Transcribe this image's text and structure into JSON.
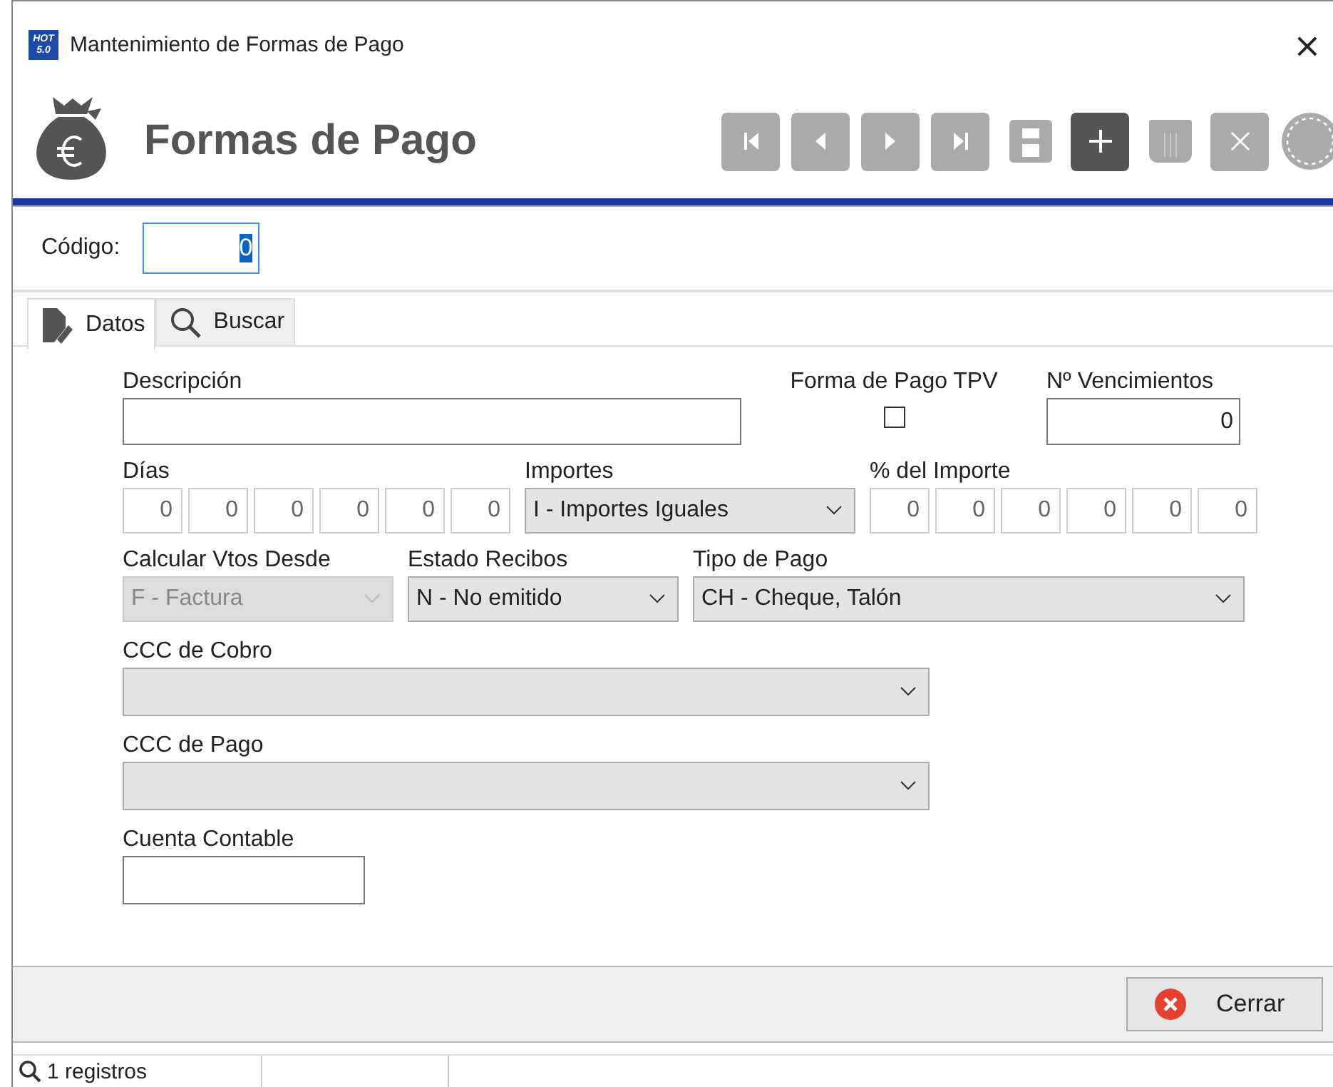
{
  "window": {
    "title": "Mantenimiento de Formas de Pago",
    "close": "×",
    "app_badge": [
      "HOT",
      "5.0"
    ]
  },
  "header": {
    "title": "Formas de Pago"
  },
  "toolbar": [
    {
      "kind": "first",
      "disabled": true
    },
    {
      "kind": "prev",
      "disabled": true
    },
    {
      "kind": "next",
      "disabled": true
    },
    {
      "kind": "last",
      "disabled": true
    },
    {
      "kind": "save",
      "disabled": true
    },
    {
      "kind": "add",
      "disabled": false
    },
    {
      "kind": "delete",
      "disabled": true
    },
    {
      "kind": "cancel",
      "disabled": true
    },
    {
      "kind": "refresh",
      "disabled": true
    }
  ],
  "codigo": {
    "label": "Código:",
    "value": "0"
  },
  "tabs": [
    {
      "label": "Datos",
      "selected": true
    },
    {
      "label": "Buscar",
      "selected": false
    }
  ],
  "form": {
    "descripcion": {
      "label": "Descripción"
    },
    "tpv": {
      "label": "Forma de Pago TPV",
      "checked": false
    },
    "vencimientos": {
      "label": "Nº Vencimientos",
      "value": "0"
    },
    "dias": {
      "label": "Días",
      "values": [
        "0",
        "0",
        "0",
        "0",
        "0",
        "0"
      ]
    },
    "importes": {
      "label": "Importes",
      "value": "I - Importes Iguales",
      "disabled": false
    },
    "porcentaje": {
      "label": "% del Importe",
      "values": [
        "0",
        "0",
        "0",
        "0",
        "0",
        "0"
      ]
    },
    "calcular": {
      "label": "Calcular Vtos Desde",
      "value": "F - Factura",
      "disabled": true
    },
    "estado": {
      "label": "Estado Recibos",
      "value": "N - No emitido",
      "disabled": false
    },
    "tipo": {
      "label": "Tipo de Pago",
      "value": "CH - Cheque, Talón",
      "disabled": false
    },
    "ccc_cobro": {
      "label": "CCC de Cobro",
      "disabled": false
    },
    "ccc_pago": {
      "label": "CCC de Pago",
      "disabled": false
    },
    "cuenta": {
      "label": "Cuenta Contable"
    }
  },
  "close_button": {
    "label": "Cerrar"
  },
  "status_bar": {
    "text": "1 registros"
  }
}
